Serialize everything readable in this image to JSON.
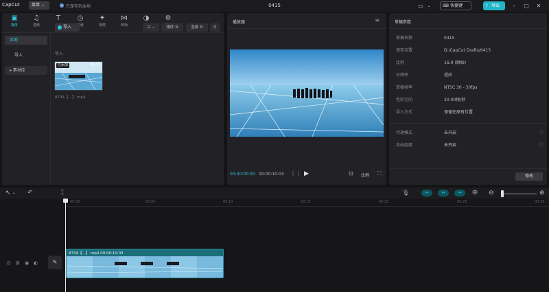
{
  "titlebar": {
    "logo": "CapCut",
    "menu_label": "菜单",
    "save_status": "已保存到本地",
    "project_name": "0415",
    "shortcut_label": "快捷键",
    "export_label": "导出"
  },
  "media": {
    "tabs": [
      {
        "icon": "▣",
        "label": "媒体"
      },
      {
        "icon": "♫",
        "label": "音频"
      },
      {
        "icon": "T",
        "label": "文本"
      },
      {
        "icon": "◷",
        "label": "贴纸"
      },
      {
        "icon": "✦",
        "label": "特效"
      },
      {
        "icon": "⋈",
        "label": "转场"
      },
      {
        "icon": "◑",
        "label": "滤镜"
      },
      {
        "icon": "⚙",
        "label": "调节"
      }
    ],
    "side_items": [
      "本地",
      "导入",
      "素材库"
    ],
    "import_label": "导入",
    "tool_buttons": [
      "☷ ⌄",
      "排序 ⇅",
      "全部 ⇅",
      "⚲"
    ],
    "section_label": "导入",
    "thumb_badge": "已添加",
    "thumb_duration": "00:11",
    "thumb_name": "8734【...】.mp4"
  },
  "player": {
    "title": "播放器",
    "menu": "≡",
    "time_current": "00:00:00:00",
    "time_total": "00:00:10:03",
    "play_icon": "▶",
    "ratio_label": "比例",
    "fullscreen_icon": "⛶"
  },
  "props": {
    "title": "草稿参数",
    "rows": [
      {
        "k": "草稿名称",
        "v": "0415",
        "q": ""
      },
      {
        "k": "保存位置",
        "v": "D:/CapCut Drafts/0415",
        "q": ""
      },
      {
        "k": "比例",
        "v": "16:9 (原始)",
        "q": ""
      },
      {
        "k": "分辨率",
        "v": "适应",
        "q": ""
      },
      {
        "k": "草稿帧率",
        "v": "NTSC 30 - 30fps",
        "q": ""
      },
      {
        "k": "色彩空间",
        "v": "30.00帧/秒",
        "q": ""
      },
      {
        "k": "导入方式",
        "v": "保留在原有位置",
        "q": ""
      },
      {
        "k": "代理模式",
        "v": "未开启",
        "q": "ⓘ"
      },
      {
        "k": "自由层级",
        "v": "未开启",
        "q": "ⓘ"
      }
    ],
    "reset_label": "修改"
  },
  "toolbar": {
    "select_icon": "↖",
    "undo_icon": "↶",
    "split_icon": "⌶",
    "mic_icon": "🎙",
    "blue1": "⇔",
    "blue2": "⇔",
    "blue3": "⇔",
    "center_icon": "中",
    "zoom_icon": "⊖",
    "zoomin_icon": "⊕"
  },
  "timeline": {
    "ticks": [
      "00:00",
      "00:05",
      "00:10",
      "00:15",
      "00:20",
      "00:25",
      "00:30"
    ],
    "clip_label": "8734【...】.mp4  00:00:10:03",
    "cover_icon": "✎"
  }
}
